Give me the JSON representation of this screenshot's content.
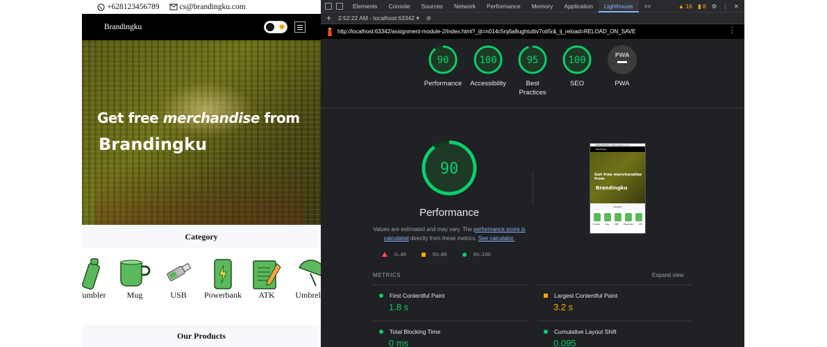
{
  "site": {
    "phone": "+628123456789",
    "email": "cs@brandingku.com",
    "brand": "Brandingku",
    "hero_line1_a": "Get free ",
    "hero_line1_em": "merchandise",
    "hero_line1_b": " from",
    "hero_line2": "Brandingku",
    "category_title": "Category",
    "categories": [
      "Tumbler",
      "Mug",
      "USB",
      "Powerbank",
      "ATK",
      "Umbrella"
    ],
    "products_title": "Our Products"
  },
  "devtools": {
    "tabs": [
      "Elements",
      "Console",
      "Sources",
      "Network",
      "Performance",
      "Memory",
      "Application",
      "Lighthouse"
    ],
    "active_tab": "Lighthouse",
    "more": ">>",
    "warnings": "16",
    "issues": "8",
    "report_time": "2:52:22 AM - localhost:63342",
    "url": "http://localhost:63342/assignment-module-2/index.html?_ijt=n014c5rq6a8ughtuttiv7oti5r&_ij_reload=RELOAD_ON_SAVE"
  },
  "scores": [
    {
      "label": "Performance",
      "value": 90
    },
    {
      "label": "Accessibility",
      "value": 100
    },
    {
      "label": "Best Practices",
      "value": 95
    },
    {
      "label": "SEO",
      "value": 100
    },
    {
      "label": "PWA",
      "value": "PWA"
    }
  ],
  "performance": {
    "score": 90,
    "label": "Performance",
    "note_a": "Values are estimated and may vary. The ",
    "note_link1": "performance score is calculated",
    "note_b": " directly from these metrics. ",
    "note_link2": "See calculator.",
    "legend": [
      "0–49",
      "50–89",
      "90–100"
    ]
  },
  "metrics": {
    "header": "METRICS",
    "expand": "Expand view",
    "items": [
      {
        "name": "First Contentful Paint",
        "value": "1.8 s",
        "status": "good"
      },
      {
        "name": "Largest Contentful Paint",
        "value": "3.2 s",
        "status": "average"
      },
      {
        "name": "Total Blocking Time",
        "value": "0 ms",
        "status": "good"
      },
      {
        "name": "Cumulative Layout Shift",
        "value": "0.095",
        "status": "good"
      }
    ]
  },
  "colors": {
    "good": "#0cce6b",
    "average": "#ffa400",
    "poor": "#ff4e42",
    "accent": "#8ab4f8",
    "brand_green": "#5cb85c"
  }
}
